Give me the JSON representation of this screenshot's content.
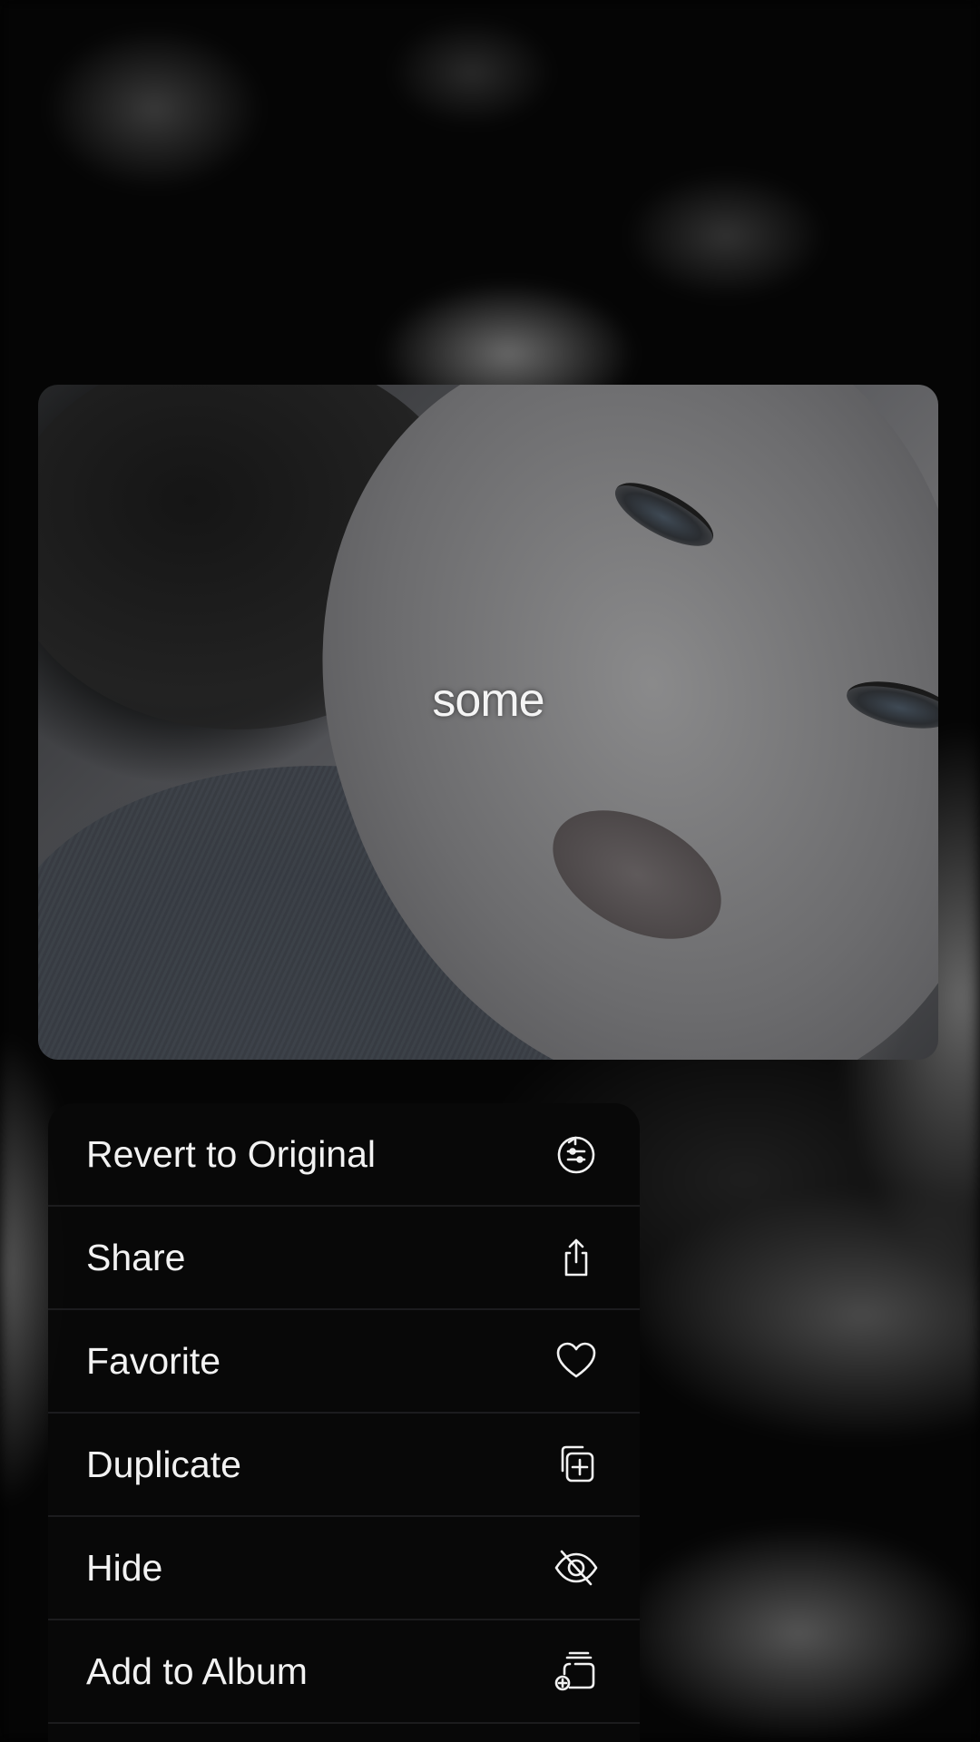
{
  "photo": {
    "caption": "some"
  },
  "menu": {
    "items": [
      {
        "label": "Revert to Original",
        "icon": "revert-icon"
      },
      {
        "label": "Share",
        "icon": "share-icon"
      },
      {
        "label": "Favorite",
        "icon": "heart-icon"
      },
      {
        "label": "Duplicate",
        "icon": "duplicate-icon"
      },
      {
        "label": "Hide",
        "icon": "eye-slash-icon"
      },
      {
        "label": "Add to Album",
        "icon": "add-to-album-icon"
      }
    ]
  },
  "colors": {
    "background": "#020202",
    "menu_background": "#080808",
    "text": "#f2f2f2",
    "separator": "#1c1c1e"
  }
}
